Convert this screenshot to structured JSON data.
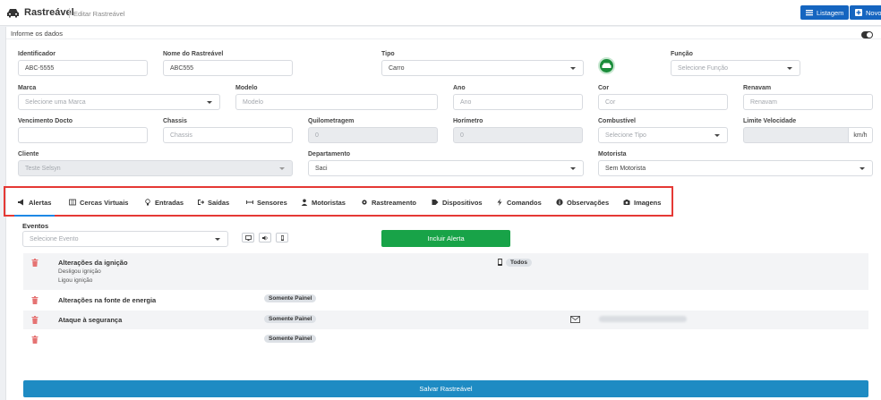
{
  "header": {
    "title": "Rastreável",
    "subtitle": "Editar Rastreável",
    "buttons": {
      "list": "Listagem",
      "new": "Novo"
    }
  },
  "form": {
    "section_title": "Informe os dados",
    "identificador": {
      "label": "Identificador",
      "value": "ABC-5555"
    },
    "nome": {
      "label": "Nome do Rastreável",
      "value": "ABC555"
    },
    "tipo": {
      "label": "Tipo",
      "value": "Carro"
    },
    "funcao": {
      "label": "Função",
      "placeholder": "Selecione Função"
    },
    "marca": {
      "label": "Marca",
      "placeholder": "Selecione uma Marca"
    },
    "modelo": {
      "label": "Modelo",
      "placeholder": "Modelo"
    },
    "ano": {
      "label": "Ano",
      "placeholder": "Ano"
    },
    "cor": {
      "label": "Cor",
      "placeholder": "Cor"
    },
    "renavam": {
      "label": "Renavam",
      "placeholder": "Renavam"
    },
    "vencimento": {
      "label": "Vencimento Docto",
      "value": ""
    },
    "chassis": {
      "label": "Chassis",
      "placeholder": "Chassis"
    },
    "quilometragem": {
      "label": "Quilometragem",
      "value": "0"
    },
    "horimetro": {
      "label": "Horímetro",
      "value": "0"
    },
    "combustivel": {
      "label": "Combustível",
      "placeholder": "Selecione Tipo"
    },
    "limite": {
      "label": "Limite Velocidade",
      "unit": "km/h"
    },
    "cliente": {
      "label": "Cliente",
      "value": "Teste Selsyn"
    },
    "departamento": {
      "label": "Departamento",
      "value": "Saci"
    },
    "motorista": {
      "label": "Motorista",
      "value": "Sem Motorista"
    }
  },
  "tabs": [
    {
      "label": "Alertas",
      "icon": "megaphone-icon",
      "active": true
    },
    {
      "label": "Cercas Virtuais",
      "icon": "map-icon"
    },
    {
      "label": "Entradas",
      "icon": "bulb-icon"
    },
    {
      "label": "Saídas",
      "icon": "exit-icon"
    },
    {
      "label": "Sensores",
      "icon": "sensor-icon"
    },
    {
      "label": "Motoristas",
      "icon": "user-icon"
    },
    {
      "label": "Rastreamento",
      "icon": "cog-icon"
    },
    {
      "label": "Dispositivos",
      "icon": "tag-icon"
    },
    {
      "label": "Comandos",
      "icon": "bolt-icon"
    },
    {
      "label": "Observações",
      "icon": "info-icon"
    },
    {
      "label": "Imagens",
      "icon": "camera-icon"
    }
  ],
  "alerts": {
    "events_label": "Eventos",
    "events_placeholder": "Selecione Evento",
    "include_button": "Incluir Alerta",
    "rows": [
      {
        "title": "Alterações da ignição",
        "subs": [
          "Desligou ignição",
          "Ligou ignição"
        ],
        "badge": "Todos"
      },
      {
        "title": "Alterações na fonte de energia",
        "badge": "Somente Painel"
      },
      {
        "title": "Ataque à segurança",
        "badge": "Somente Painel"
      },
      {
        "title": "",
        "badge": "Somente Painel"
      }
    ]
  },
  "save_button": "Salvar Rastreável",
  "colors": {
    "primary": "#1565c0",
    "success": "#18a348",
    "danger": "#e53935",
    "save": "#1e8bc3"
  }
}
